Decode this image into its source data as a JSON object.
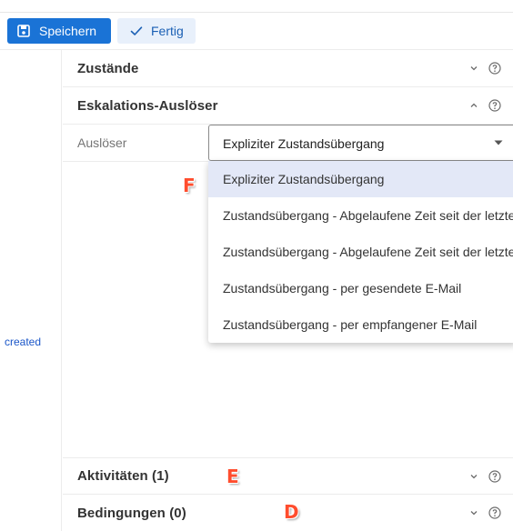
{
  "toolbar": {
    "save_label": "Speichern",
    "done_label": "Fertig"
  },
  "left_panel": {
    "link_text": "created"
  },
  "sections": {
    "states": {
      "title": "Zustände",
      "expanded": false
    },
    "escalation_triggers": {
      "title": "Eskalations-Auslöser",
      "expanded": true
    },
    "activities": {
      "title": "Aktivitäten (1)",
      "expanded": false
    },
    "conditions": {
      "title": "Bedingungen (0)",
      "expanded": false
    }
  },
  "trigger_field": {
    "label": "Auslöser",
    "value": "Expliziter Zustandsübergang",
    "options": [
      "Expliziter Zustandsübergang",
      "Zustandsübergang - Abgelaufene Zeit seit der letzten",
      "Zustandsübergang - Abgelaufene Zeit seit der letzten",
      "Zustandsübergang - per gesendete E-Mail",
      "Zustandsübergang - per empfangener E-Mail"
    ],
    "selected_index": 0
  },
  "markers": {
    "f": "F",
    "e": "E",
    "d": "D"
  },
  "colors": {
    "primary": "#1a73d6",
    "secondary_bg": "#e8f0fb",
    "selected_option_bg": "#e3e8f7",
    "marker": "#ff4d2e"
  }
}
